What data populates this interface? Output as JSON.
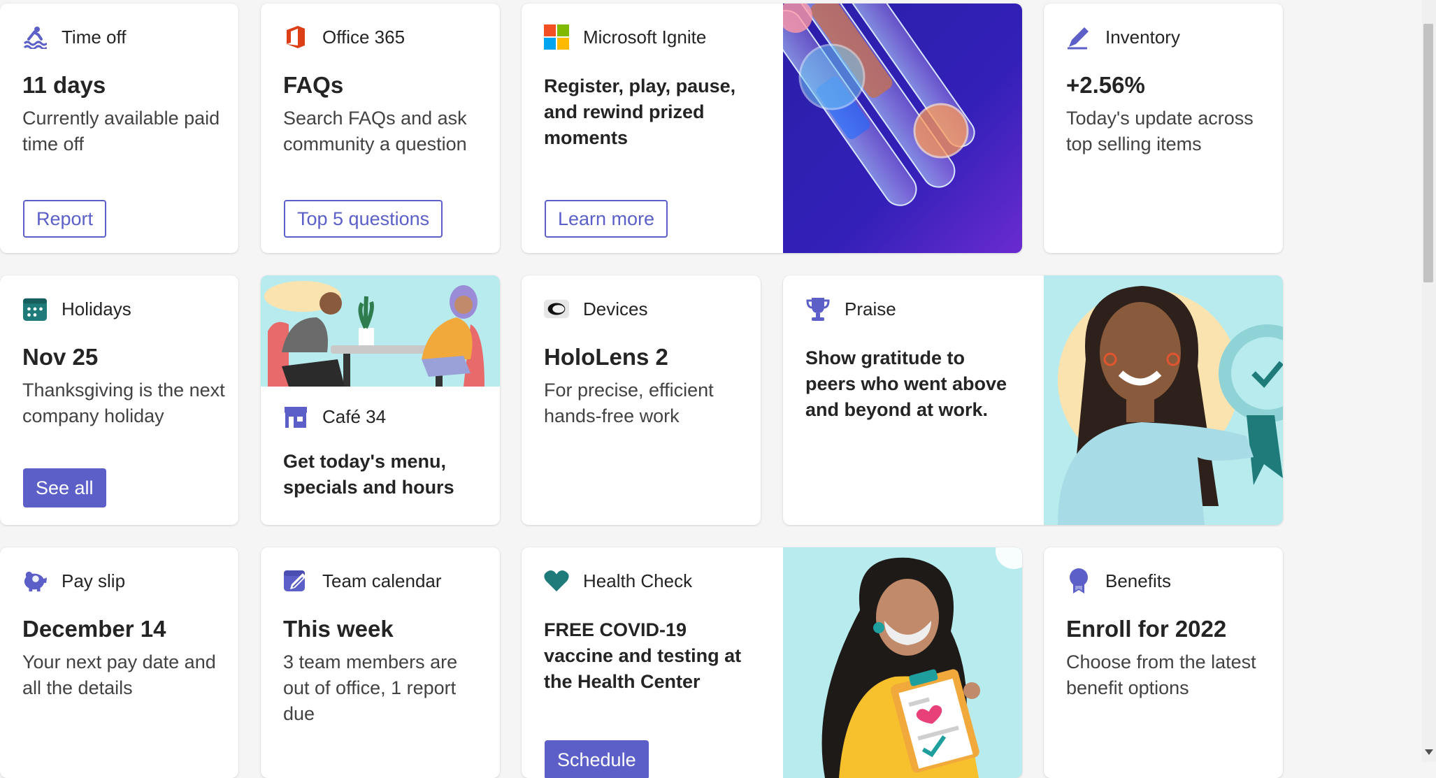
{
  "colors": {
    "accent": "#5b5fc7",
    "teal": "#1f7a7a",
    "art_blue": "#3b1fb8",
    "art_mint": "#b7ebee"
  },
  "row1": {
    "timeoff": {
      "icon": "swimmer-icon",
      "label": "Time off",
      "title": "11 days",
      "desc": "Currently available paid time off",
      "button": "Report"
    },
    "office": {
      "icon": "office-365-icon",
      "label": "Office 365",
      "title": "FAQs",
      "desc": "Search FAQs and ask community a question",
      "button": "Top 5 questions"
    },
    "ignite": {
      "icon": "microsoft-logo-icon",
      "label": "Microsoft Ignite",
      "desc": "Register, play, pause, and rewind prized moments",
      "button": "Learn more"
    },
    "inventory": {
      "icon": "pen-icon",
      "label": "Inventory",
      "title": "+2.56%",
      "desc": "Today's update across top selling items"
    }
  },
  "row2": {
    "holidays": {
      "icon": "calendar-icon",
      "label": "Holidays",
      "title": "Nov 25",
      "desc": "Thanksgiving is the next company holiday",
      "button": "See all"
    },
    "cafe": {
      "icon": "store-icon",
      "label": "Café 34",
      "desc": "Get today's menu, specials and hours"
    },
    "devices": {
      "icon": "hololens-icon",
      "label": "Devices",
      "title": "HoloLens 2",
      "desc": "For precise, efficient hands-free work"
    },
    "praise": {
      "icon": "trophy-icon",
      "label": "Praise",
      "desc": "Show gratitude to peers who went above and beyond at work."
    }
  },
  "row3": {
    "payslip": {
      "icon": "piggy-bank-icon",
      "label": "Pay slip",
      "title": "December 14",
      "desc": "Your next pay date and all the details"
    },
    "teamcal": {
      "icon": "calendar-edit-icon",
      "label": "Team calendar",
      "title": "This week",
      "desc": "3 team members are out of office, 1 report due"
    },
    "health": {
      "icon": "heart-icon",
      "label": "Health Check",
      "desc": "FREE COVID-19 vaccine and testing at the Health Center",
      "button": "Schedule"
    },
    "benefits": {
      "icon": "ribbon-icon",
      "label": "Benefits",
      "title": "Enroll for 2022",
      "desc": "Choose from the latest benefit options"
    }
  }
}
